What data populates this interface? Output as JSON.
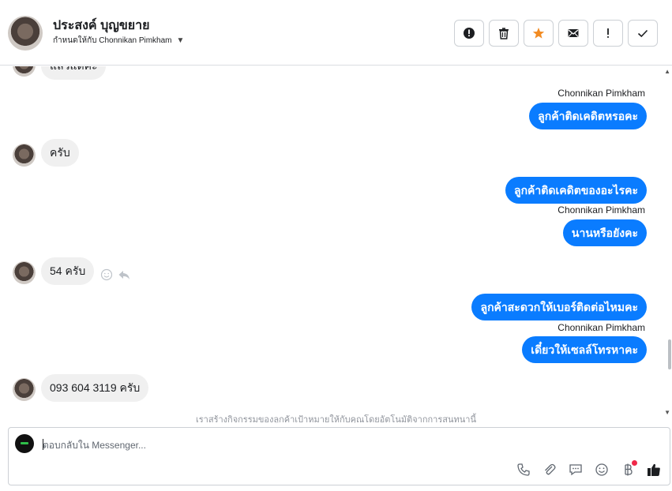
{
  "header": {
    "contact_name": "ประสงค์ บุญขยาย",
    "assigned_to": "กำหนดให้กับ Chonnikan Pimkham",
    "actions": [
      {
        "name": "report-spam-button",
        "icon": "alert-circle-icon"
      },
      {
        "name": "delete-button",
        "icon": "trash-icon"
      },
      {
        "name": "star-button",
        "icon": "star-icon",
        "color": "#f28b22"
      },
      {
        "name": "mark-unread-button",
        "icon": "envelope-icon"
      },
      {
        "name": "follow-up-button",
        "icon": "exclamation-icon"
      },
      {
        "name": "mark-done-button",
        "icon": "check-icon"
      }
    ]
  },
  "chat": {
    "top_partial_message": "แล้วแต่คะ",
    "sender_name": "Chonnikan Pimkham",
    "messages": [
      {
        "from": "page",
        "text": "ลูกค้าติดเคดิตหรอคะ"
      },
      {
        "from": "customer",
        "text": "ครับ"
      },
      {
        "from": "page",
        "text": "ลูกค้าติดเคดิตของอะไรคะ"
      },
      {
        "from": "page",
        "text": "นานหรือยังคะ"
      },
      {
        "from": "customer",
        "text": "54 ครับ"
      },
      {
        "from": "page",
        "text": "ลูกค้าสะดวกให้เบอร์ติดต่อไหมคะ"
      },
      {
        "from": "page",
        "text": "เดี๋ยวให้เซลล์โทรหาคะ"
      },
      {
        "from": "customer",
        "text": "093 604 3119 ครับ"
      }
    ],
    "notice": "เราสร้างกิจกรรมของลูกค้าเป้าหมายให้กับคุณโดยอัตโนมัติจากการสนทนานี้"
  },
  "composer": {
    "placeholder": "ตอบกลับใน Messenger...",
    "tools": [
      "phone-icon",
      "attachment-icon",
      "saved-reply-icon",
      "emoji-icon",
      "baht-payment-icon",
      "thumbs-up-icon"
    ]
  },
  "colors": {
    "outgoing_bubble": "#0a7cff",
    "incoming_bubble": "#f0f0f0",
    "star": "#f28b22",
    "notification_dot": "#f02849"
  }
}
